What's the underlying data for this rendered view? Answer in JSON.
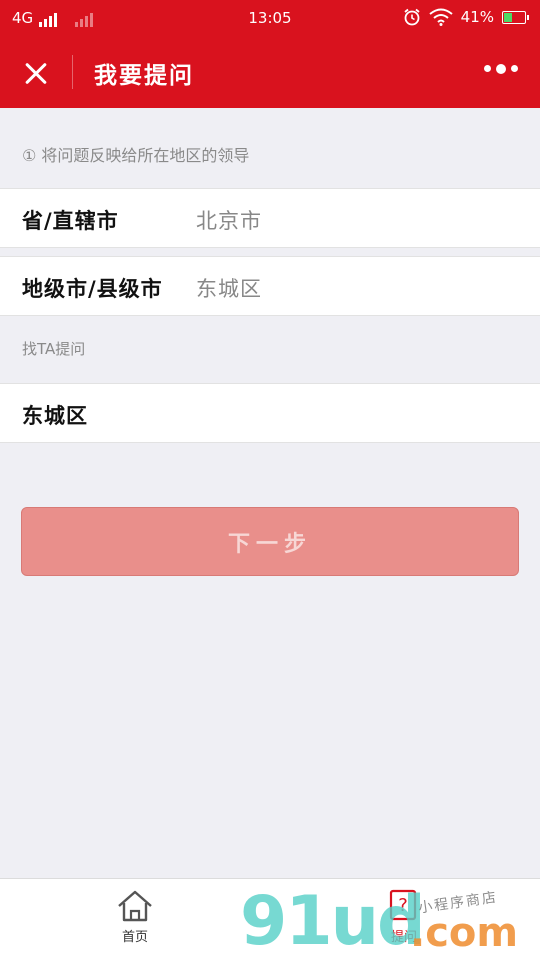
{
  "status_bar": {
    "network": "4G",
    "time": "13:05",
    "battery_percent": "41%",
    "battery_level": 0.41,
    "icons": [
      "signal-icon",
      "alarm-icon",
      "wifi-icon",
      "battery-icon"
    ]
  },
  "nav": {
    "title": "我要提问",
    "close_icon": "close-icon",
    "more_icon": "more-dots-icon"
  },
  "form": {
    "hint": "① 将问题反映给所在地区的领导",
    "province_label": "省/直辖市",
    "province_value": "北京市",
    "city_label": "地级市/县级市",
    "city_value": "东城区",
    "ask_section_label": "找TA提问",
    "target_value": "东城区",
    "next_button": "下一步"
  },
  "tabbar": {
    "home_label": "首页",
    "ask_label": "提问"
  },
  "watermark": {
    "big": "91ud",
    "com": ".com",
    "small": "小程序商店"
  },
  "colors": {
    "brand_red": "#d9121e",
    "button_disabled": "#e98f8b",
    "background": "#efeff4"
  }
}
